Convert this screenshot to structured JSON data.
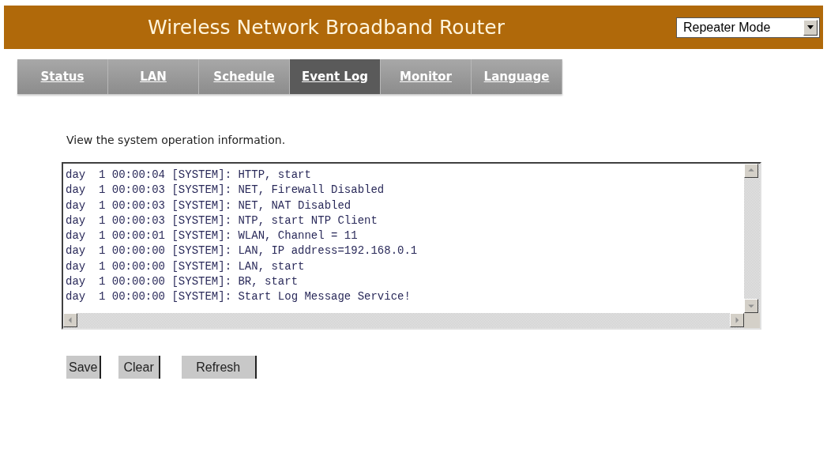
{
  "header": {
    "title": "Wireless Network Broadband Router",
    "mode_select": {
      "value": "Repeater Mode"
    }
  },
  "tabs": [
    {
      "label": "Status",
      "selected": false
    },
    {
      "label": "LAN",
      "selected": false
    },
    {
      "label": "Schedule",
      "selected": false
    },
    {
      "label": "Event Log",
      "selected": true
    },
    {
      "label": "Monitor",
      "selected": false
    },
    {
      "label": "Language",
      "selected": false
    }
  ],
  "description": "View the system operation information.",
  "log": [
    "day  1 00:00:04 [SYSTEM]: HTTP, start",
    "day  1 00:00:03 [SYSTEM]: NET, Firewall Disabled",
    "day  1 00:00:03 [SYSTEM]: NET, NAT Disabled",
    "day  1 00:00:03 [SYSTEM]: NTP, start NTP Client",
    "day  1 00:00:01 [SYSTEM]: WLAN, Channel = 11",
    "day  1 00:00:00 [SYSTEM]: LAN, IP address=192.168.0.1",
    "day  1 00:00:00 [SYSTEM]: LAN, start",
    "day  1 00:00:00 [SYSTEM]: BR, start",
    "day  1 00:00:00 [SYSTEM]: Start Log Message Service!"
  ],
  "buttons": [
    "Save",
    "Clear",
    "Refresh"
  ]
}
